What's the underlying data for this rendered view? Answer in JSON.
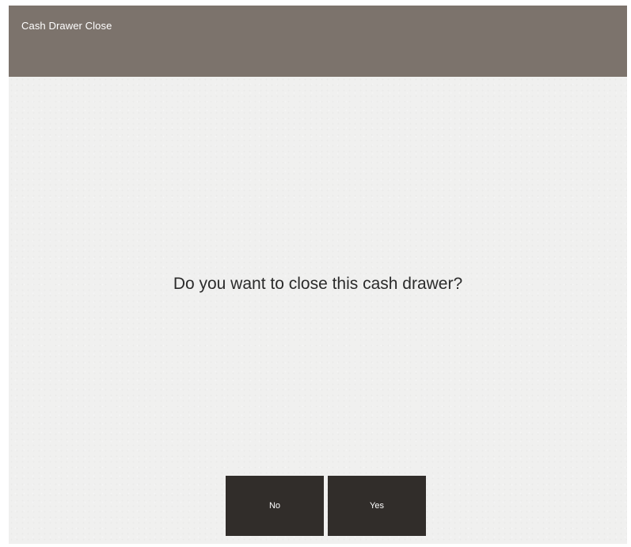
{
  "window": {
    "title": "Cash Drawer Close"
  },
  "dialog": {
    "message": "Do you want to close this cash drawer?",
    "buttons": {
      "no_label": "No",
      "yes_label": "Yes"
    }
  },
  "colors": {
    "title_bar": "#7c736c",
    "background": "#f0f0ef",
    "button": "#312d2a",
    "button_text": "#ffffff",
    "message_text": "#2b2b2b"
  }
}
